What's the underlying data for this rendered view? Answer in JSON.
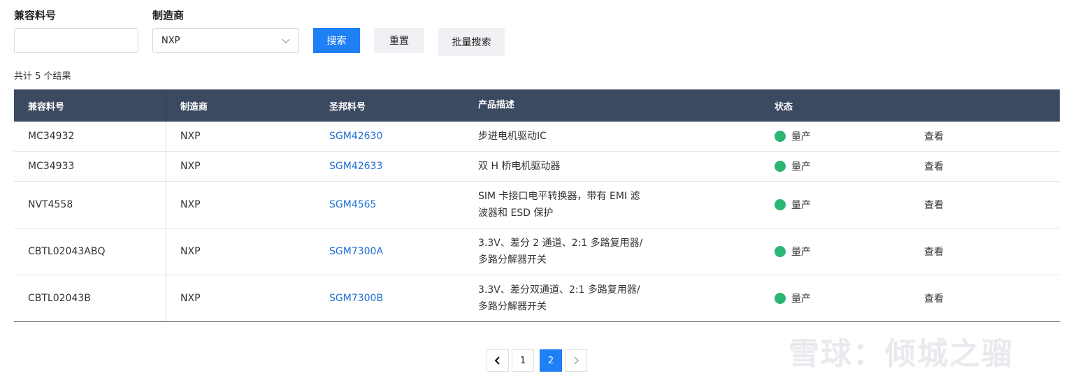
{
  "filters": {
    "part_label": "兼容料号",
    "part_value": "",
    "maker_label": "制造商",
    "maker_value": "NXP",
    "search_label": "搜索",
    "reset_label": "重置",
    "batch_label": "批量搜索"
  },
  "result_count": "共计 5 个结果",
  "table": {
    "headers": [
      "兼容料号",
      "制造商",
      "圣邦料号",
      "产品描述",
      "状态",
      ""
    ],
    "rows": [
      {
        "part": "MC34932",
        "maker": "NXP",
        "sgm": "SGM42630",
        "desc": "步进电机驱动IC",
        "status": "量产",
        "action": "查看"
      },
      {
        "part": "MC34933",
        "maker": "NXP",
        "sgm": "SGM42633",
        "desc": "双 H 桥电机驱动器",
        "status": "量产",
        "action": "查看"
      },
      {
        "part": "NVT4558",
        "maker": "NXP",
        "sgm": "SGM4565",
        "desc_line1": "SIM 卡接口电平转换器，带有 EMI 滤",
        "desc_line2": "波器和 ESD 保护",
        "status": "量产",
        "action": "查看"
      },
      {
        "part": "CBTL02043ABQ",
        "maker": "NXP",
        "sgm": "SGM7300A",
        "desc_line1": "3.3V、差分 2 通道、2:1 多路复用器/",
        "desc_line2": "多路分解器开关",
        "status": "量产",
        "action": "查看"
      },
      {
        "part": "CBTL02043B",
        "maker": "NXP",
        "sgm": "SGM7300B",
        "desc_line1": "3.3V、差分双通道、2:1 多路复用器/",
        "desc_line2": "多路分解器开关",
        "status": "量产",
        "action": "查看"
      }
    ],
    "status_color": "#2bb673"
  },
  "pagination": {
    "prev_icon": "chevron-left-icon",
    "pages": [
      "1",
      "2"
    ],
    "current": "2",
    "next_icon": "chevron-right-icon"
  },
  "watermark": "雪球：倾城之骝",
  "colors": {
    "primary": "#1f7ff5",
    "header_bg": "#3c4a61",
    "link": "#1f6fd6"
  }
}
